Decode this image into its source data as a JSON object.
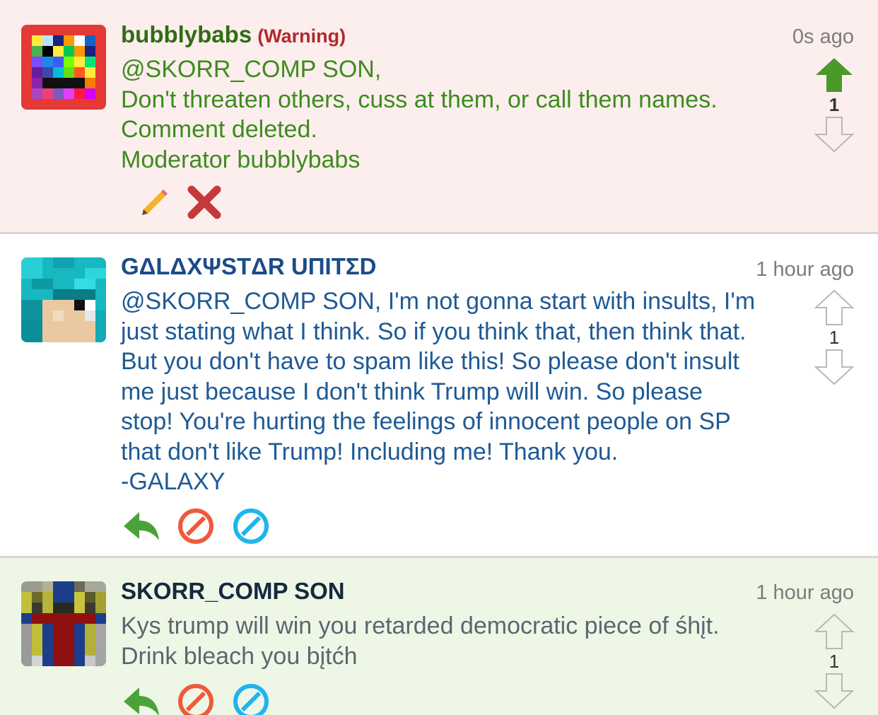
{
  "comments": [
    {
      "username": "bubblybabs",
      "warning": "(Warning)",
      "time": "0s ago",
      "lines": [
        "@SKORR_COMP SON,",
        "Don't threaten others, cuss at them, or call them names.",
        "Comment deleted.",
        "Moderator bubblybabs"
      ],
      "score": "1",
      "upvoted": true,
      "actions": [
        "pencil-icon",
        "delete-x-icon"
      ]
    },
    {
      "username": "GΔLΔXΨSTΔR UΠITΣD",
      "time": "1 hour ago",
      "lines": [
        "@SKORR_COMP SON, I'm not gonna start with insults, I'm",
        "just stating what I think. So if you think that, then think that.",
        "But you don't have to spam like this! So please don't insult",
        "me just because I don't think Trump will win. So please",
        "stop! You're hurting the feelings of innocent people on SP",
        "that don't like Trump! Including me! Thank you.",
        "-GALAXY"
      ],
      "score": "1",
      "upvoted": false,
      "actions": [
        "reply-icon",
        "block-red-icon",
        "block-blue-icon"
      ]
    },
    {
      "username": "SKORR_COMP SON",
      "time": "1 hour ago",
      "lines": [
        "Kys trump will win you retarded democratic piece of śhįt.",
        "Drink bleach you bįtćh"
      ],
      "score": "1",
      "upvoted": false,
      "actions": [
        "reply-icon",
        "block-red-icon",
        "block-blue-icon"
      ]
    }
  ],
  "colors": {
    "upvote_active": "#4a9a2a",
    "reply_green": "#4aa33a",
    "block_red": "#ee5a3c",
    "block_blue": "#1fb5ec",
    "delete_red": "#c43a3a"
  }
}
